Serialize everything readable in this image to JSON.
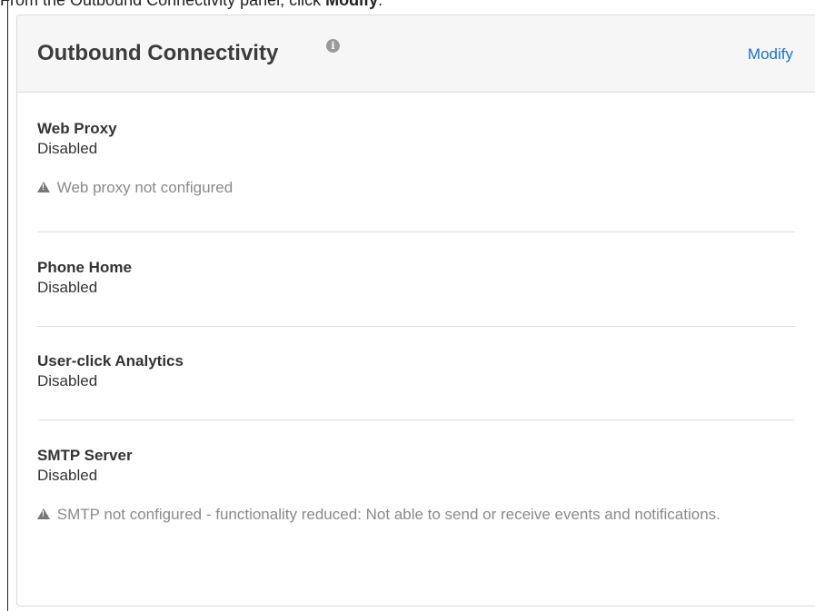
{
  "instruction": {
    "prefix": "From the Outbound Connectivity panel, click ",
    "action": "Modify",
    "suffix": "."
  },
  "panel": {
    "title": "Outbound Connectivity",
    "info_icon": "info-icon",
    "modify_label": "Modify",
    "link_color": "#1a73c8"
  },
  "sections": [
    {
      "title": "Web Proxy",
      "value": "Disabled",
      "warning": "Web proxy not configured",
      "warning_icon": "warning-icon"
    },
    {
      "title": "Phone Home",
      "value": "Disabled"
    },
    {
      "title": "User-click Analytics",
      "value": "Disabled"
    },
    {
      "title": "SMTP Server",
      "value": "Disabled",
      "warning": "SMTP not configured - functionality reduced: Not able to send or receive events and notifications.",
      "warning_icon": "warning-icon"
    }
  ]
}
